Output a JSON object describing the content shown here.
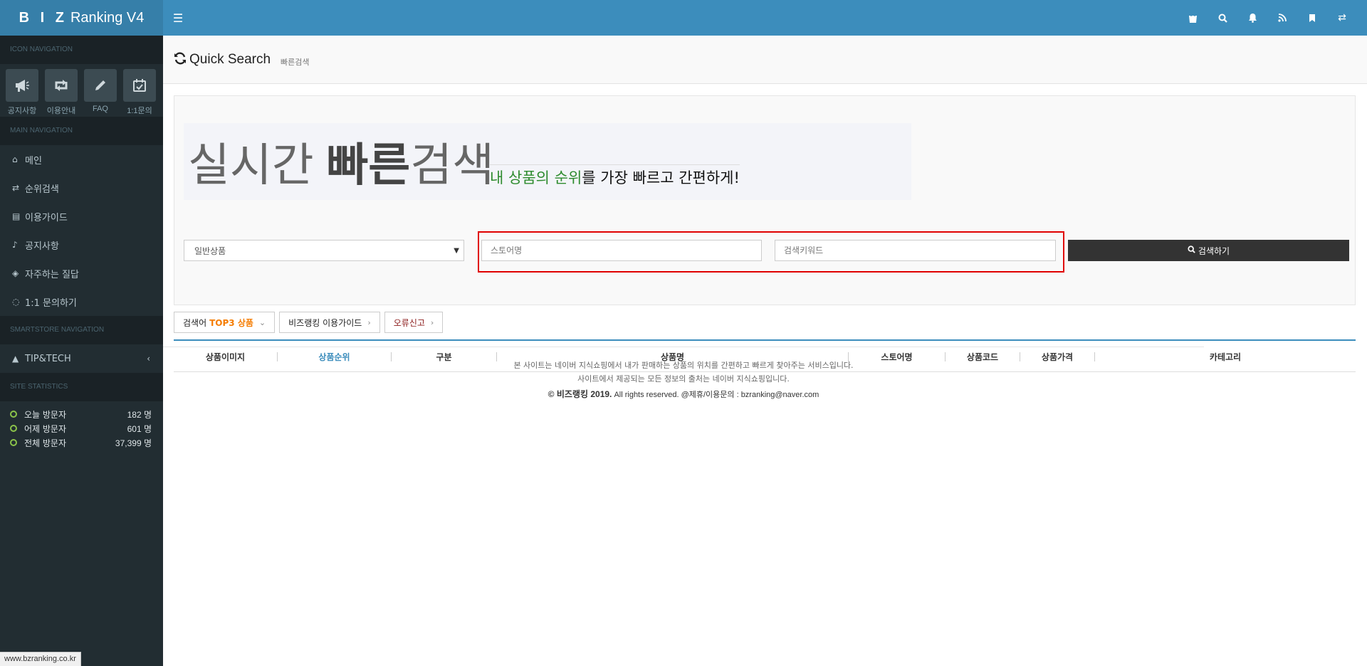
{
  "header": {
    "logo_prefix": "B I Z",
    "logo_rest": "Ranking V4",
    "menu_icon": "hamburger-icon",
    "right_icons": [
      "shopping-bag-icon",
      "search-icon",
      "bell-icon",
      "rss-icon",
      "bookmark-icon",
      "exchange-icon"
    ]
  },
  "sidebar": {
    "icon_nav_header": "ICON NAVIGATION",
    "icon_nav": [
      {
        "label": "공지사항",
        "icon": "megaphone-icon"
      },
      {
        "label": "이용안내",
        "icon": "retweet-icon"
      },
      {
        "label": "FAQ",
        "icon": "pencil-icon"
      },
      {
        "label": "1:1문의",
        "icon": "calendar-check-icon"
      }
    ],
    "main_nav_header": "MAIN NAVIGATION",
    "main_nav": [
      {
        "label": "메인",
        "icon": "home-icon"
      },
      {
        "label": "순위검색",
        "icon": "exchange-icon"
      },
      {
        "label": "이용가이드",
        "icon": "book-icon"
      },
      {
        "label": "공지사항",
        "icon": "bell-icon"
      },
      {
        "label": "자주하는 질답",
        "icon": "tags-icon"
      },
      {
        "label": "1:1 문의하기",
        "icon": "comment-icon"
      }
    ],
    "smartstore_header": "SMARTSTORE NAVIGATION",
    "smartstore_nav": [
      {
        "label": "TIP&TECH",
        "icon": "warning-icon"
      }
    ],
    "stats_header": "SITE STATISTICS",
    "stats": [
      {
        "label": "오늘 방문자",
        "value": "182 명"
      },
      {
        "label": "어제 방문자",
        "value": "601 명"
      },
      {
        "label": "전체 방문자",
        "value": "37,399 명"
      }
    ]
  },
  "page": {
    "title": "Quick Search",
    "subtitle": "빠른검색"
  },
  "hero": {
    "big_part1": "실시간 ",
    "big_bold": "빠른",
    "big_part2": "검색",
    "tag_green": "내 상품의 순위",
    "tag_rest": "를 가장 빠르고 간편하게!"
  },
  "search": {
    "select_value": "일반상품",
    "store_placeholder": "스토어명",
    "keyword_placeholder": "검색키워드",
    "button_label": "검색하기"
  },
  "tabs": {
    "top3_prefix": "검색어",
    "top3_highlight": "TOP3 상품",
    "guide": "비즈랭킹 이용가이드",
    "report": "오류신고"
  },
  "table": {
    "columns": [
      "상품이미지",
      "상품순위",
      "구분",
      "상품명",
      "스토어명",
      "상품코드",
      "상품가격",
      "카테고리"
    ]
  },
  "footer": {
    "line1": "본 사이트는 네이버 지식쇼핑에서 내가 판매하는 상품의 위치를 간편하고 빠르게 찾아주는 서비스입니다.",
    "line2": "사이트에서 제공되는 모든 정보의 출처는 네이버 지식쇼핑입니다.",
    "copyright": "© 비즈랭킹 2019.",
    "rights": "All rights reserved. @제휴/이용문의 : bzranking@naver.com"
  },
  "status_url": "www.bzranking.co.kr"
}
